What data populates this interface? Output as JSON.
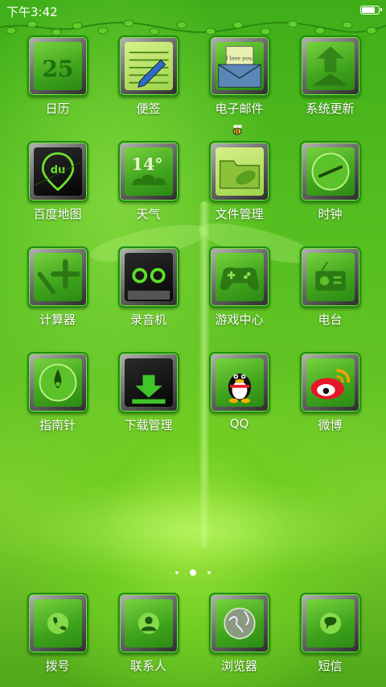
{
  "status": {
    "time": "下午3:42",
    "battery_level": 0.85
  },
  "apps": [
    {
      "label": "日历",
      "icon": "calendar-icon",
      "number": "25"
    },
    {
      "label": "便签",
      "icon": "notepad-icon"
    },
    {
      "label": "电子邮件",
      "icon": "email-icon",
      "note": "I love you."
    },
    {
      "label": "系统更新",
      "icon": "system-update-icon"
    },
    {
      "label": "百度地图",
      "icon": "baidu-map-icon",
      "badge": "du"
    },
    {
      "label": "天气",
      "icon": "weather-icon",
      "temp": "14°"
    },
    {
      "label": "文件管理",
      "icon": "folder-icon"
    },
    {
      "label": "时钟",
      "icon": "clock-icon"
    },
    {
      "label": "计算器",
      "icon": "calculator-icon"
    },
    {
      "label": "录音机",
      "icon": "recorder-icon"
    },
    {
      "label": "游戏中心",
      "icon": "gamepad-icon"
    },
    {
      "label": "电台",
      "icon": "radio-icon"
    },
    {
      "label": "指南针",
      "icon": "compass-icon"
    },
    {
      "label": "下载管理",
      "icon": "download-icon"
    },
    {
      "label": "QQ",
      "icon": "qq-penguin-icon"
    },
    {
      "label": "微博",
      "icon": "weibo-icon"
    }
  ],
  "pager": {
    "pages": 3,
    "active": 1
  },
  "dock": [
    {
      "label": "拨号",
      "icon": "phone-icon"
    },
    {
      "label": "联系人",
      "icon": "contacts-icon"
    },
    {
      "label": "浏览器",
      "icon": "browser-icon"
    },
    {
      "label": "短信",
      "icon": "message-icon"
    }
  ],
  "colors": {
    "accent": "#1e8d12",
    "tile_highlight": "#7fe03e",
    "background": "#4fb81d"
  }
}
